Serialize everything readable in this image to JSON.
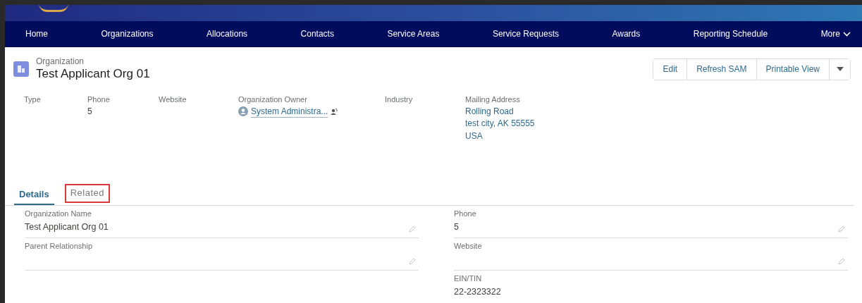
{
  "nav": {
    "items": [
      {
        "label": "Home"
      },
      {
        "label": "Organizations"
      },
      {
        "label": "Allocations"
      },
      {
        "label": "Contacts"
      },
      {
        "label": "Service Areas"
      },
      {
        "label": "Service Requests"
      },
      {
        "label": "Awards"
      },
      {
        "label": "Reporting Schedule"
      }
    ],
    "more": "More"
  },
  "record": {
    "object_type": "Organization",
    "title": "Test Applicant Org 01"
  },
  "actions": [
    "Edit",
    "Refresh SAM",
    "Printable View"
  ],
  "highlights": [
    {
      "label": "Type"
    },
    {
      "label": "Phone",
      "value": "5"
    },
    {
      "label": "Website"
    },
    {
      "label": "Organization Owner",
      "value": "System Administra...",
      "kind": "owner"
    },
    {
      "label": "Industry"
    },
    {
      "label": "Mailing Address",
      "lines": [
        "Rolling Road",
        "test city, AK 55555",
        "USA"
      ],
      "kind": "address"
    }
  ],
  "tabs": [
    {
      "label": "Details",
      "selected": true,
      "highlighted": false
    },
    {
      "label": "Related",
      "selected": false,
      "highlighted": true
    }
  ],
  "fields_left": [
    {
      "label": "Organization Name",
      "value": "Test Applicant Org 01",
      "editable": true
    },
    {
      "label": "Parent Relationship",
      "editable": true
    }
  ],
  "fields_right": [
    {
      "label": "Phone",
      "value": "5",
      "editable": true
    },
    {
      "label": "Website",
      "editable": true
    },
    {
      "label": "EIN/TIN",
      "value": "22-2323322",
      "editable": false
    }
  ]
}
